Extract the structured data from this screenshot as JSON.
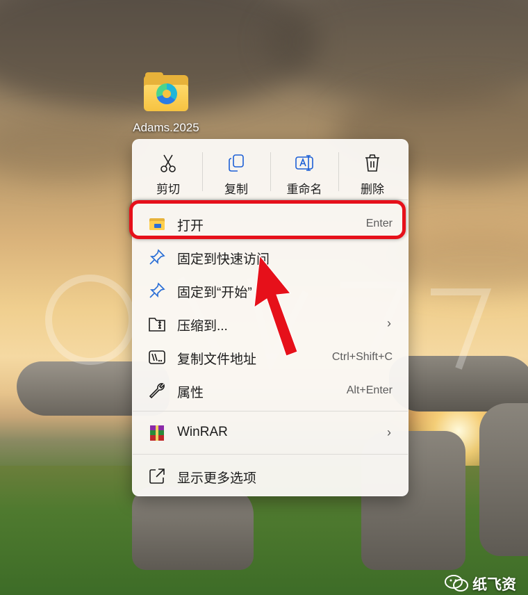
{
  "desktop": {
    "icon_label": "Adams.2025"
  },
  "quick_actions": [
    {
      "label": "剪切",
      "icon": "scissors-icon"
    },
    {
      "label": "复制",
      "icon": "copy-icon"
    },
    {
      "label": "重命名",
      "icon": "rename-icon"
    },
    {
      "label": "删除",
      "icon": "trash-icon"
    }
  ],
  "menu_items": [
    {
      "label": "打开",
      "shortcut": "Enter",
      "icon": "folder-icon"
    },
    {
      "label": "固定到快速访问",
      "shortcut": "",
      "icon": "pin-icon"
    },
    {
      "label": "固定到“开始”",
      "shortcut": "",
      "icon": "pin-icon"
    },
    {
      "label": "压缩到...",
      "shortcut": "",
      "icon": "zip-folder-icon",
      "submenu": true
    },
    {
      "label": "复制文件地址",
      "shortcut": "Ctrl+Shift+C",
      "icon": "copy-path-icon"
    },
    {
      "label": "属性",
      "shortcut": "Alt+Enter",
      "icon": "wrench-icon"
    },
    {
      "label": "WinRAR",
      "shortcut": "",
      "icon": "winrar-icon",
      "submenu": true
    },
    {
      "label": "显示更多选项",
      "shortcut": "",
      "icon": "share-icon"
    }
  ],
  "watermark": {
    "text": "纸飞资"
  },
  "colors": {
    "highlight": "#e6101a",
    "arrow": "#e6101a"
  }
}
